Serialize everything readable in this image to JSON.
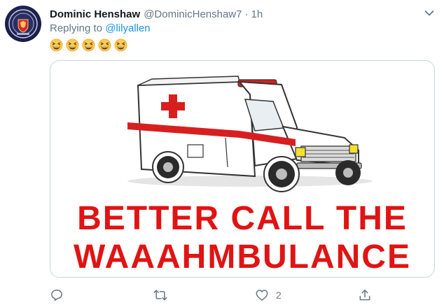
{
  "tweet": {
    "display_name": "Dominic Henshaw",
    "handle": "@DominicHenshaw7",
    "separator": "·",
    "time": "1h",
    "replying_prefix": "Replying to",
    "replying_to": "@lilyallen",
    "emoji_icons": [
      "grinning-squinting-face-icon",
      "grinning-squinting-face-icon",
      "grinning-squinting-face-icon",
      "grinning-squinting-face-icon",
      "grinning-squinting-face-icon"
    ],
    "media": {
      "line1": "BETTER CALL THE",
      "line2": "WAAAHMBULANCE"
    },
    "actions": {
      "reply_count": "",
      "retweet_count": "",
      "like_count": "2",
      "share_count": ""
    }
  },
  "colors": {
    "link": "#1b95e0",
    "muted": "#657786",
    "caption_red": "#e01414"
  }
}
